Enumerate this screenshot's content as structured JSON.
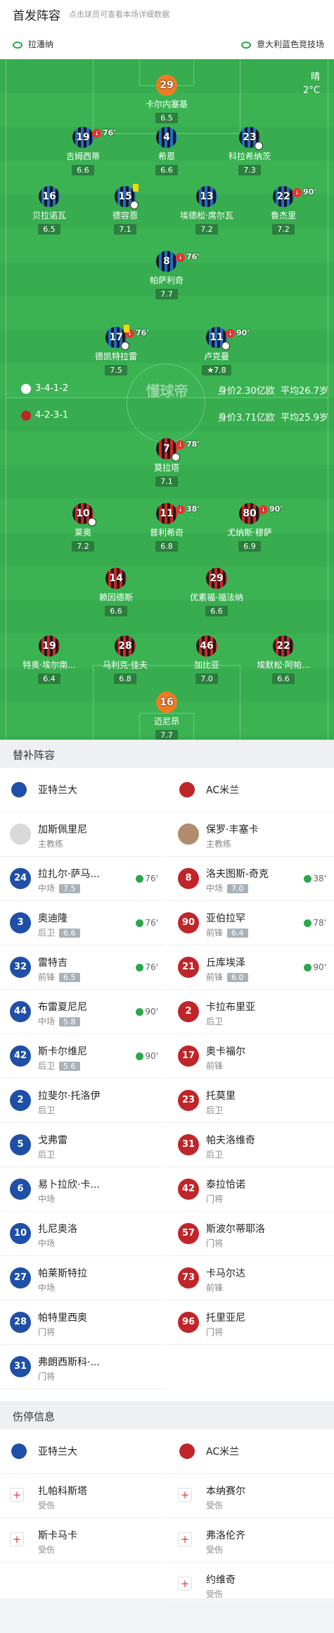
{
  "header": {
    "title": "首发阵容",
    "subtitle": "点击球员可查看本场详细数据"
  },
  "stadium": {
    "left": "拉潘纳",
    "right": "意大利蓝色竞技场"
  },
  "weather": {
    "cond": "晴",
    "temp": "2°C"
  },
  "atalanta": {
    "formation": "3-4-1-2",
    "value": "身价2.30亿欧",
    "age": "平均26.7岁"
  },
  "milan": {
    "formation": "4-2-3-1",
    "value": "身价3.71亿欧",
    "age": "平均25.9岁"
  },
  "badge": "懂球帝",
  "players": [
    {
      "n": "29",
      "name": "卡尔内塞基",
      "r": "6.5"
    },
    {
      "n": "19",
      "name": "吉姆西蒂",
      "r": "6.6",
      "sub": "76'"
    },
    {
      "n": "4",
      "name": "希恩",
      "r": "6.6"
    },
    {
      "n": "23",
      "name": "科拉希纳茨",
      "r": "7.3"
    },
    {
      "n": "16",
      "name": "贝拉诺瓦",
      "r": "6.5"
    },
    {
      "n": "15",
      "name": "德容恩",
      "r": "7.1"
    },
    {
      "n": "13",
      "name": "埃德松·席尔瓦",
      "r": "7.2"
    },
    {
      "n": "22",
      "name": "鲁杰里",
      "r": "7.2",
      "sub": "90'"
    },
    {
      "n": "8",
      "name": "帕萨利奇",
      "r": "7.7",
      "sub": "76'"
    },
    {
      "n": "17",
      "name": "德凯特拉雷",
      "r": "7.5",
      "sub": "76'"
    },
    {
      "n": "11",
      "name": "卢克曼",
      "r": "7.8",
      "sub": "90'"
    },
    {
      "n": "7",
      "name": "莫拉塔",
      "r": "7.1",
      "sub": "78'"
    },
    {
      "n": "10",
      "name": "莱奥",
      "r": "7.2"
    },
    {
      "n": "11",
      "name": "普利希奇",
      "r": "6.8",
      "sub": "38'"
    },
    {
      "n": "80",
      "name": "尤纳斯·穆萨",
      "r": "6.9",
      "sub": "90'"
    },
    {
      "n": "14",
      "name": "赖因德斯",
      "r": "6.6"
    },
    {
      "n": "29",
      "name": "优素福·福法纳",
      "r": "6.6"
    },
    {
      "n": "19",
      "name": "特奥·埃尔南...",
      "r": "6.4"
    },
    {
      "n": "28",
      "name": "马利克·佳夫",
      "r": "6.8"
    },
    {
      "n": "46",
      "name": "加比亚",
      "r": "7.0"
    },
    {
      "n": "22",
      "name": "埃默松·阿帕...",
      "r": "6.6"
    },
    {
      "n": "16",
      "name": "迈尼昂",
      "r": "7.7"
    }
  ],
  "subs_title": "替补阵容",
  "injury_title": "伤停信息",
  "teams": {
    "home": "亚特兰大",
    "away": "AC米兰"
  },
  "coaches": {
    "home": {
      "name": "加斯佩里尼",
      "role": "主教练"
    },
    "away": {
      "name": "保罗·丰塞卡",
      "role": "主教练"
    }
  },
  "subs_home": [
    {
      "n": "24",
      "name": "拉扎尔·萨马...",
      "pos": "中场",
      "r": "7.5",
      "m": "76'"
    },
    {
      "n": "3",
      "name": "奥迪隆",
      "pos": "后卫",
      "r": "6.6",
      "m": "76'"
    },
    {
      "n": "32",
      "name": "雷特吉",
      "pos": "前锋",
      "r": "6.5",
      "m": "76'"
    },
    {
      "n": "44",
      "name": "布雷夏尼尼",
      "pos": "中场",
      "r": "5.8",
      "m": "90'"
    },
    {
      "n": "42",
      "name": "斯卡尔维尼",
      "pos": "后卫",
      "r": "5.6",
      "m": "90'"
    },
    {
      "n": "2",
      "name": "拉斐尔·托洛伊",
      "pos": "后卫"
    },
    {
      "n": "5",
      "name": "戈弗雷",
      "pos": "后卫"
    },
    {
      "n": "6",
      "name": "易卜拉欣·卡...",
      "pos": "中场"
    },
    {
      "n": "10",
      "name": "扎尼奥洛",
      "pos": "中场"
    },
    {
      "n": "27",
      "name": "帕莱斯特拉",
      "pos": "中场"
    },
    {
      "n": "28",
      "name": "帕特里西奥",
      "pos": "门将"
    },
    {
      "n": "31",
      "name": "弗朗西斯科·...",
      "pos": "门将"
    }
  ],
  "subs_away": [
    {
      "n": "8",
      "name": "洛夫图斯-奇克",
      "pos": "中场",
      "r": "7.0",
      "m": "38'"
    },
    {
      "n": "90",
      "name": "亚伯拉罕",
      "pos": "前锋",
      "r": "6.4",
      "m": "78'"
    },
    {
      "n": "21",
      "name": "丘库埃泽",
      "pos": "前锋",
      "r": "6.0",
      "m": "90'"
    },
    {
      "n": "2",
      "name": "卡拉布里亚",
      "pos": "后卫"
    },
    {
      "n": "17",
      "name": "奥卡福尔",
      "pos": "前锋"
    },
    {
      "n": "23",
      "name": "托莫里",
      "pos": "后卫"
    },
    {
      "n": "31",
      "name": "帕夫洛维奇",
      "pos": "后卫"
    },
    {
      "n": "42",
      "name": "泰拉恰诺",
      "pos": "门将"
    },
    {
      "n": "57",
      "name": "斯波尔蒂耶洛",
      "pos": "门将"
    },
    {
      "n": "73",
      "name": "卡马尔达",
      "pos": "前锋"
    },
    {
      "n": "96",
      "name": "托里亚尼",
      "pos": "门将"
    }
  ],
  "injuries_home": [
    {
      "name": "扎帕科斯塔",
      "s": "受伤"
    },
    {
      "name": "斯卡马卡",
      "s": "受伤"
    }
  ],
  "injuries_away": [
    {
      "name": "本纳赛尔",
      "s": "受伤"
    },
    {
      "name": "弗洛伦齐",
      "s": "受伤"
    },
    {
      "name": "约维奇",
      "s": "受伤"
    }
  ]
}
